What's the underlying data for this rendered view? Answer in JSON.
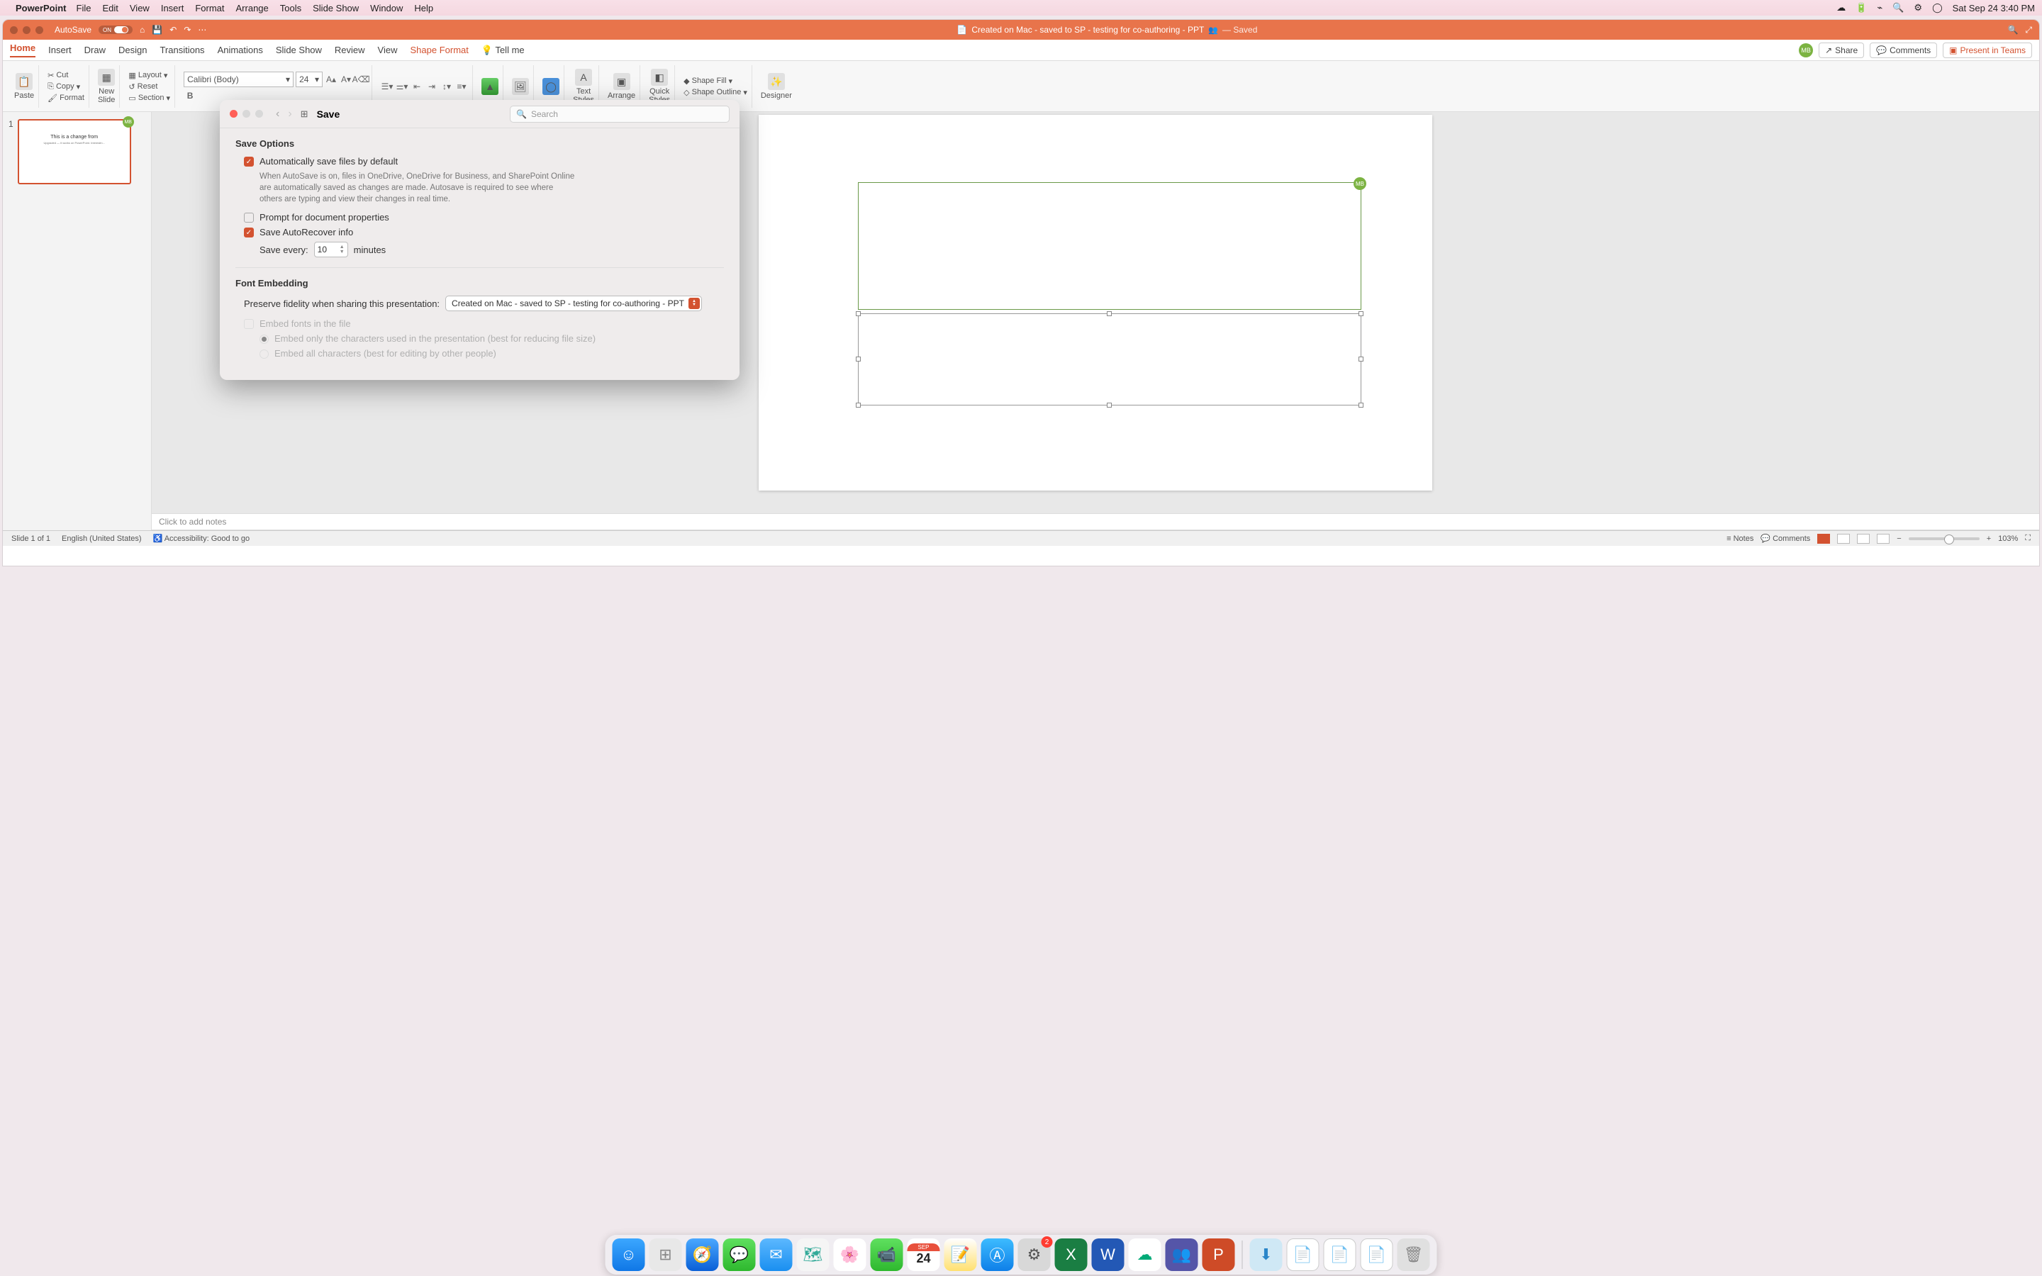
{
  "menubar": {
    "app": "PowerPoint",
    "items": [
      "File",
      "Edit",
      "View",
      "Insert",
      "Format",
      "Arrange",
      "Tools",
      "Slide Show",
      "Window",
      "Help"
    ],
    "datetime": "Sat Sep 24  3:40 PM"
  },
  "titlebar": {
    "autosave_label": "AutoSave",
    "autosave_state": "ON",
    "doc_title": "Created on Mac - saved to SP - testing for co-authoring - PPT",
    "saved_suffix": "— Saved"
  },
  "ribbon_tabs": [
    "Home",
    "Insert",
    "Draw",
    "Design",
    "Transitions",
    "Animations",
    "Slide Show",
    "Review",
    "View",
    "Shape Format"
  ],
  "tell_me": "Tell me",
  "share": "Share",
  "comments_btn": "Comments",
  "present_btn": "Present in Teams",
  "user_initials": "MB",
  "ribbon": {
    "paste": "Paste",
    "cut": "Cut",
    "copy": "Copy",
    "format": "Format",
    "new_slide": "New\nSlide",
    "layout": "Layout",
    "reset": "Reset",
    "section": "Section",
    "font_name": "Calibri (Body)",
    "font_size": "24",
    "bold": "B",
    "arrange": "Arrange",
    "quick_styles": "Quick\nStyles",
    "text_styles": "Text\nStyles",
    "shape_fill": "Shape Fill",
    "shape_outline": "Shape Outline",
    "designer": "Designer"
  },
  "thumbnail": {
    "number": "1",
    "title": "This is a change from",
    "subtitle": "Upgraded — it works on PowerPoint. Interesitn..."
  },
  "notes_placeholder": "Click to add notes",
  "statusbar": {
    "slide": "Slide 1 of 1",
    "lang": "English (United States)",
    "accessibility": "Accessibility: Good to go",
    "notes": "Notes",
    "comments": "Comments",
    "zoom": "103%"
  },
  "modal": {
    "title": "Save",
    "search_placeholder": "Search",
    "section_save": "Save Options",
    "auto_save_label": "Automatically save files by default",
    "auto_save_desc": "When AutoSave is on, files in OneDrive, OneDrive for Business, and SharePoint Online are automatically saved as changes are made. Autosave is required to see where others are typing and view their changes in real time.",
    "prompt_label": "Prompt for document properties",
    "autorecover_label": "Save AutoRecover info",
    "save_every_label": "Save every:",
    "save_every_value": "10",
    "minutes": "minutes",
    "section_font": "Font Embedding",
    "preserve_label": "Preserve fidelity when sharing this presentation:",
    "preserve_value": "Created on Mac - saved to SP - testing for co-authoring - PPT",
    "embed_fonts": "Embed fonts in the file",
    "embed_only": "Embed only the characters used in the presentation (best for reducing file size)",
    "embed_all": "Embed all characters (best for editing by other people)"
  },
  "dock": {
    "cal_month": "SEP",
    "cal_day": "24",
    "settings_badge": "2"
  }
}
